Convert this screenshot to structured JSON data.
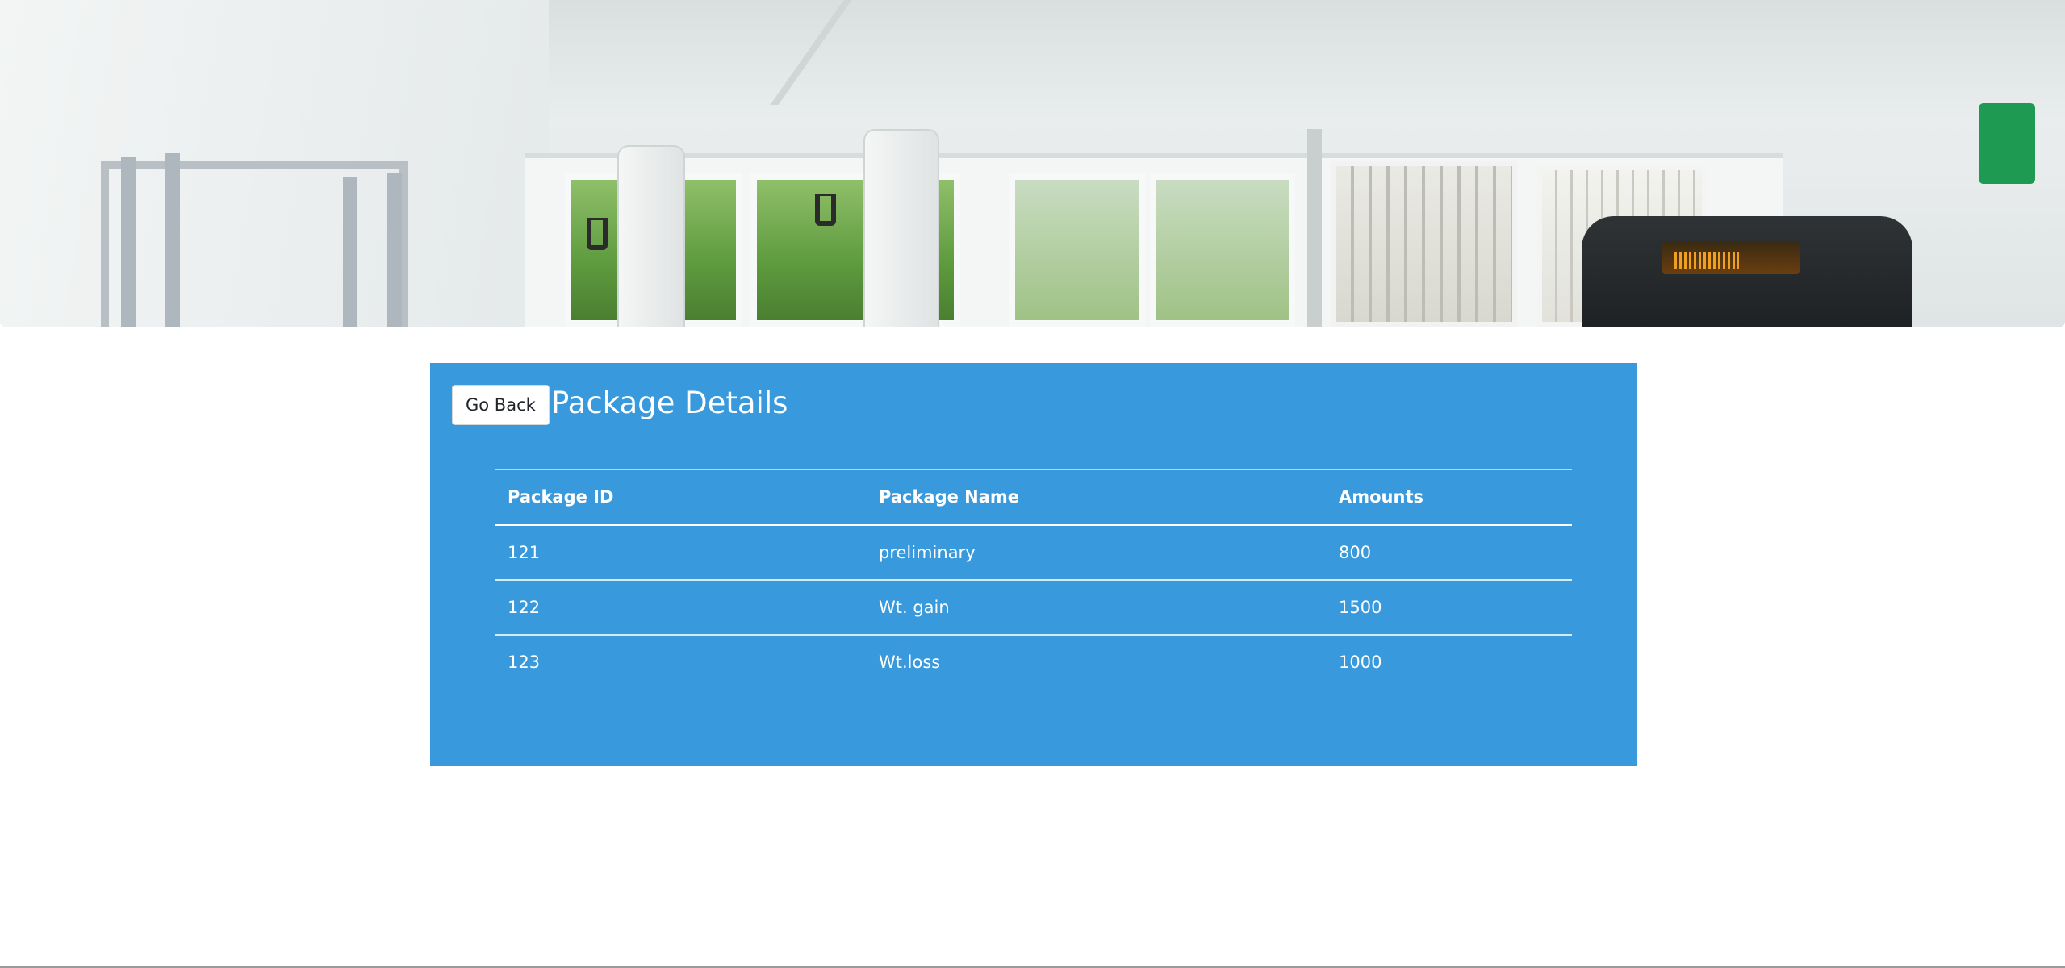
{
  "banner": {
    "image_description_icon": "gym-interior-photo"
  },
  "panel": {
    "background_color": "#3899dc",
    "go_back_label": "Go Back",
    "title": "Package Details"
  },
  "table": {
    "headers": [
      "Package ID",
      "Package Name",
      "Amounts"
    ],
    "rows": [
      {
        "id": "121",
        "name": "preliminary",
        "amount": "800"
      },
      {
        "id": "122",
        "name": "Wt. gain",
        "amount": "1500"
      },
      {
        "id": "123",
        "name": "Wt.loss",
        "amount": "1000"
      }
    ]
  }
}
